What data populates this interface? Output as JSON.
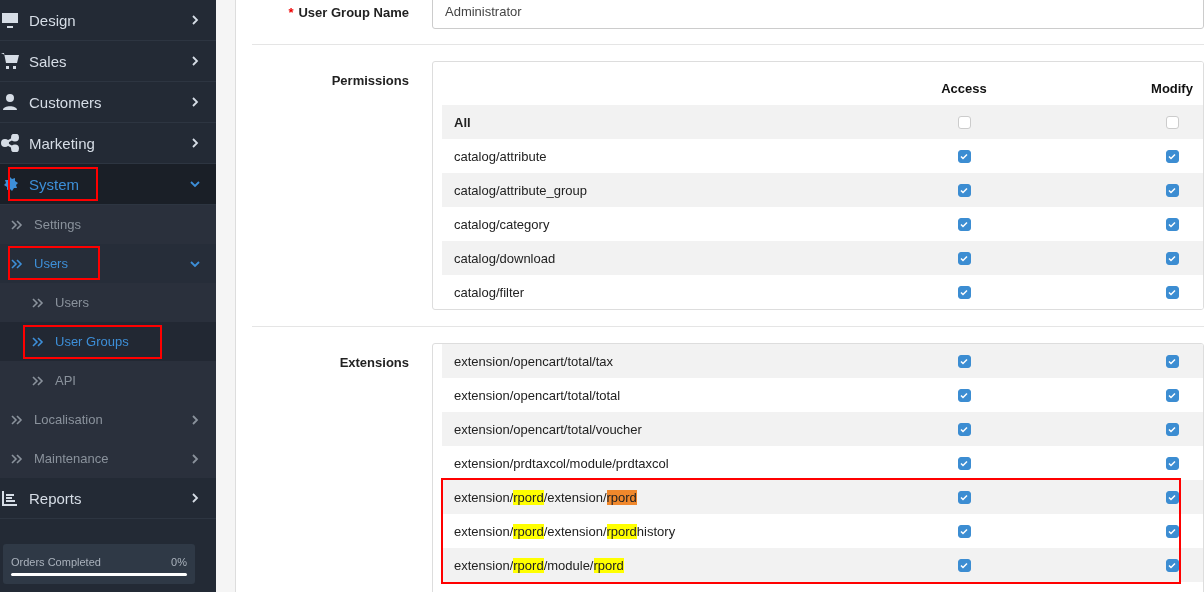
{
  "sidebar": {
    "menu": [
      {
        "label": "Design",
        "expanded": false,
        "selected": false,
        "outlined": false
      },
      {
        "label": "Sales",
        "expanded": false,
        "selected": false,
        "outlined": false
      },
      {
        "label": "Customers",
        "expanded": false,
        "selected": false,
        "outlined": false
      },
      {
        "label": "Marketing",
        "expanded": false,
        "selected": false,
        "outlined": false
      },
      {
        "label": "System",
        "expanded": true,
        "selected": true,
        "outlined": true,
        "children": [
          {
            "label": "Settings",
            "expanded": false,
            "selected": false,
            "outlined": false,
            "has_children": false
          },
          {
            "label": "Users",
            "expanded": true,
            "selected": true,
            "outlined": true,
            "has_children": true,
            "children": [
              {
                "label": "Users",
                "selected": false,
                "outlined": false
              },
              {
                "label": "User Groups",
                "selected": true,
                "outlined": true
              },
              {
                "label": "API",
                "selected": false,
                "outlined": false
              }
            ]
          },
          {
            "label": "Localisation",
            "expanded": false,
            "selected": false,
            "outlined": false,
            "has_children": true
          },
          {
            "label": "Maintenance",
            "expanded": false,
            "selected": false,
            "outlined": false,
            "has_children": true
          }
        ]
      },
      {
        "label": "Reports",
        "expanded": false,
        "selected": false,
        "outlined": false
      }
    ],
    "progress": [
      {
        "label": "Orders Completed",
        "reading": "0%",
        "level": 0
      }
    ]
  },
  "form": {
    "name_field": {
      "label": "User Group Name",
      "required_mark": "*",
      "value": "Administrator"
    },
    "permissions": {
      "label": "Permissions",
      "columns": [
        "Access",
        "Modify"
      ],
      "rows": [
        {
          "name": [
            {
              "text": "All"
            }
          ],
          "bold": true,
          "access": false,
          "modify": false,
          "outlined": false
        },
        {
          "name": [
            {
              "text": "catalog/attribute"
            }
          ],
          "bold": false,
          "access": true,
          "modify": true,
          "outlined": false
        },
        {
          "name": [
            {
              "text": "catalog/attribute_group"
            }
          ],
          "bold": false,
          "access": true,
          "modify": true,
          "outlined": false
        },
        {
          "name": [
            {
              "text": "catalog/category"
            }
          ],
          "bold": false,
          "access": true,
          "modify": true,
          "outlined": false
        },
        {
          "name": [
            {
              "text": "catalog/download"
            }
          ],
          "bold": false,
          "access": true,
          "modify": true,
          "outlined": false
        },
        {
          "name": [
            {
              "text": "catalog/filter"
            }
          ],
          "bold": false,
          "access": true,
          "modify": true,
          "outlined": false
        }
      ]
    },
    "extensions": {
      "label": "Extensions",
      "rows": [
        {
          "name": [
            {
              "text": "extension/opencart/total/tax"
            }
          ],
          "bold": false,
          "access": true,
          "modify": true,
          "outlined": false
        },
        {
          "name": [
            {
              "text": "extension/opencart/total/total"
            }
          ],
          "bold": false,
          "access": true,
          "modify": true,
          "outlined": false
        },
        {
          "name": [
            {
              "text": "extension/opencart/total/voucher"
            }
          ],
          "bold": false,
          "access": true,
          "modify": true,
          "outlined": false
        },
        {
          "name": [
            {
              "text": "extension/prdtaxcol/module/prdtaxcol"
            }
          ],
          "bold": false,
          "access": true,
          "modify": true,
          "outlined": false
        },
        {
          "name": [
            {
              "text": "extension/"
            },
            {
              "text": "rpord",
              "color": "#ffff00"
            },
            {
              "text": "/extension/"
            },
            {
              "text": "rpord",
              "color": "#f0882c"
            }
          ],
          "bold": false,
          "access": true,
          "modify": true,
          "outlined": true
        },
        {
          "name": [
            {
              "text": "extension/"
            },
            {
              "text": "rpord",
              "color": "#ffff00"
            },
            {
              "text": "/extension/"
            },
            {
              "text": "rpord",
              "color": "#ffff00"
            },
            {
              "text": "history"
            }
          ],
          "bold": false,
          "access": true,
          "modify": true,
          "outlined": true
        },
        {
          "name": [
            {
              "text": "extension/"
            },
            {
              "text": "rpord",
              "color": "#ffff00"
            },
            {
              "text": "/module/"
            },
            {
              "text": "rpord",
              "color": "#ffff00"
            }
          ],
          "bold": false,
          "access": true,
          "modify": true,
          "outlined": true
        }
      ]
    }
  }
}
